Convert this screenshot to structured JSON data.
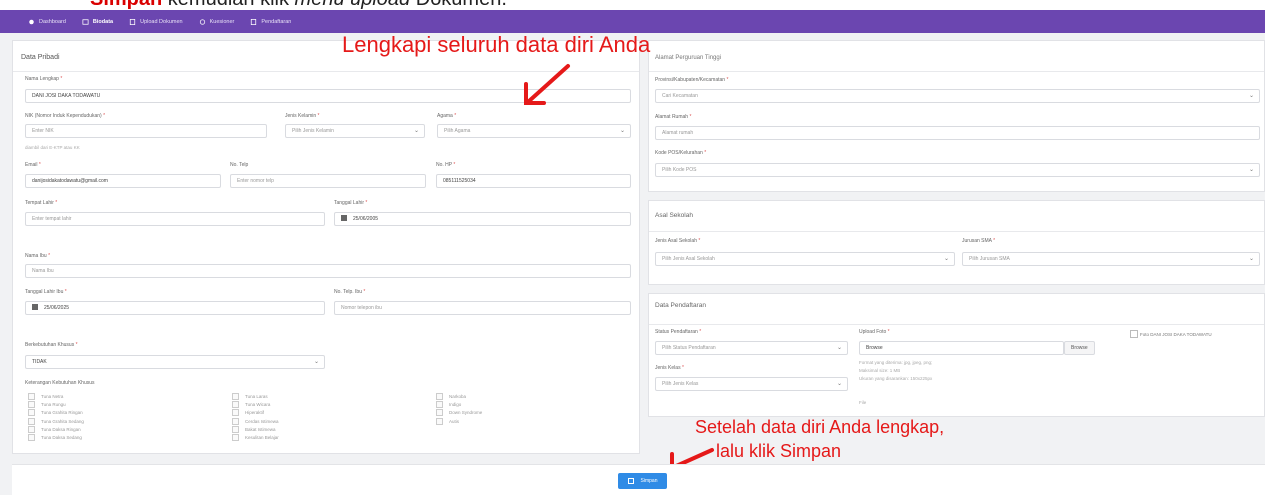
{
  "caption": {
    "bold": "Simpan",
    "text": " kemudian klik ",
    "italic": "menu upload",
    "rest": " Dokumen."
  },
  "nav": [
    {
      "label": "Dashboard",
      "icon": "dashboard-icon"
    },
    {
      "label": "Biodata",
      "icon": "id-card-icon"
    },
    {
      "label": "Upload Dokumen",
      "icon": "upload-icon"
    },
    {
      "label": "Kuesioner",
      "icon": "question-icon"
    },
    {
      "label": "Pendaftaran",
      "icon": "form-icon"
    }
  ],
  "left": {
    "title": "Data Pribadi",
    "nama_label": "Nama Lengkap",
    "nama_value": "DANI JOSI DAKA TODAWATU",
    "nik_label": "NIK (Nomor Induk Kependudukan)",
    "nik_placeholder": "Enter NIK",
    "nik_hint": "diambil dari E-KTP atau KK",
    "jk_label": "Jenis Kelamin",
    "jk_placeholder": "Pilih Jenis Kelamin",
    "agama_label": "Agama",
    "agama_placeholder": "Pilih Agama",
    "email_label": "Email",
    "email_value": "danijosidakatodawatu@gmail.com",
    "telp_label": "No. Telp",
    "telp_placeholder": "Enter nomor telp",
    "hp_label": "No. HP",
    "hp_value": "085111525034",
    "tempat_label": "Tempat Lahir",
    "tempat_placeholder": "Enter tempat lahir",
    "tgl_label": "Tanggal Lahir",
    "tgl_value": "25/06/2005",
    "ibu_label": "Nama Ibu",
    "ibu_placeholder": "Nama Ibu",
    "tglibu_label": "Tanggal Lahir Ibu",
    "tglibu_value": "25/06/2025",
    "telpibu_label": "No. Telp. Ibu",
    "telpibu_placeholder": "Nomor telepon ibu",
    "khusus_label": "Berkebutuhan Khusus",
    "khusus_value": "TIDAK",
    "ket_label": "Keterangan Kebutuhan Khusus",
    "checks_col1": [
      "Tuna Netra",
      "Tuna Rungu",
      "Tuna Grahita Ringan",
      "Tuna Grahita Sedang",
      "Tuna Daksa Ringan",
      "Tuna Daksa Sedang"
    ],
    "checks_col2": [
      "Tuna Laras",
      "Tuna Wicara",
      "Hiperaktif",
      "Cerdas Istimewa",
      "Bakat Istimewa",
      "Kesulitan Belajar"
    ],
    "checks_col3": [
      "Narkoba",
      "Indigo",
      "Down Syndrome",
      "Autis"
    ]
  },
  "alamat": {
    "title": "Alamat Perguruan Tinggi",
    "prov_label": "Provinsi/Kabupaten/Kecamatan",
    "prov_placeholder": "Cari Kecamatan",
    "alamat_label": "Alamat Rumah",
    "alamat_placeholder": "Alamat rumah",
    "pos_label": "Kode POS/Kelurahan",
    "pos_placeholder": "Pilih Kode POS"
  },
  "sekolah": {
    "title": "Asal Sekolah",
    "jenis_label": "Jenis Asal Sekolah",
    "jenis_placeholder": "Pilih Jenis Asal Sekolah",
    "jurusan_label": "Jurusan SMA",
    "jurusan_placeholder": "Pilih Jurusan SMA"
  },
  "daftar": {
    "title": "Data Pendaftaran",
    "status_label": "Status Pendaftaran",
    "status_placeholder": "Pilih Status Pendaftaran",
    "kelas_label": "Jenis Kelas",
    "kelas_placeholder": "Pilih Jenis Kelas",
    "foto_label": "Upload Foto",
    "foto_value": "Browse",
    "browse_label": "Browse",
    "hint1": "Format yang diterima: jpg, jpeg, png;",
    "hint2": "Maksimal size: 1 MB",
    "hint3": "Ukuran yang disarankan: 150x225px",
    "hint4": "File",
    "photo_alt": "Foto DANI JOSI DAKA TODAWATU"
  },
  "annotation_top": "Lengkapi seluruh data diri Anda",
  "annotation_bottom_1": "Setelah data diri Anda lengkap,",
  "annotation_bottom_2": "lalu klik Simpan",
  "save_label": "Simpan"
}
